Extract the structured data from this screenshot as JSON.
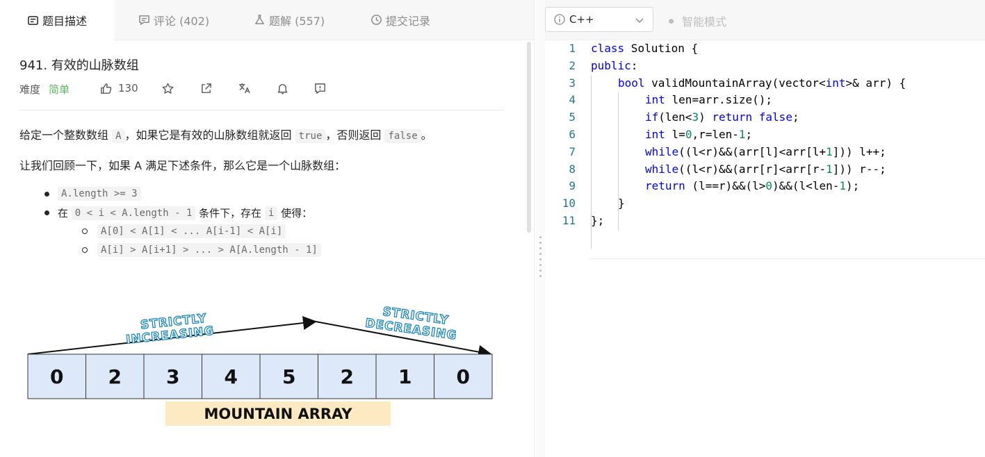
{
  "tabs": [
    {
      "label": "题目描述",
      "icon": "description-icon"
    },
    {
      "label": "评论 (402)",
      "icon": "comment-icon"
    },
    {
      "label": "题解 (557)",
      "icon": "flask-icon"
    },
    {
      "label": "提交记录",
      "icon": "clock-icon"
    }
  ],
  "problem": {
    "title": "941. 有效的山脉数组",
    "difficulty_label": "难度",
    "difficulty": "简单",
    "likes": "130"
  },
  "description": {
    "p1_a": "给定一个整数数组",
    "p1_code1": "A",
    "p1_b": "，如果它是有效的山脉数组就返回",
    "p1_code2": "true",
    "p1_c": "，否则返回",
    "p1_code3": "false",
    "p1_d": "。",
    "p2": "让我们回顾一下，如果 A 满足下述条件，那么它是一个山脉数组：",
    "b1_code": "A.length >= 3",
    "b2_a": "在",
    "b2_code1": "0 < i  < A.length - 1",
    "b2_b": "条件下，存在",
    "b2_code2": "i",
    "b2_c": "使得：",
    "b3_code": "A[0] < A[1] < ... A[i-1] < A[i]",
    "b4_code": "A[i] > A[i+1] > ... > A[A.length - 1]"
  },
  "diagram": {
    "left_label_1": "STRICTLY",
    "left_label_2": "INCREASING",
    "right_label_1": "STRICTLY",
    "right_label_2": "DECREASING",
    "values": [
      "0",
      "2",
      "3",
      "4",
      "5",
      "2",
      "1",
      "0"
    ],
    "caption": "MOUNTAIN ARRAY"
  },
  "editor": {
    "language": "C++",
    "smart_mode": "智能模式"
  },
  "code_lines": [
    {
      "n": "1",
      "indent": 0,
      "tokens": [
        {
          "t": "class",
          "c": "kw"
        },
        {
          "t": " Solution {",
          "c": ""
        }
      ]
    },
    {
      "n": "2",
      "indent": 0,
      "tokens": [
        {
          "t": "public",
          "c": "kw"
        },
        {
          "t": ":",
          "c": ""
        }
      ]
    },
    {
      "n": "3",
      "indent": 1,
      "tokens": [
        {
          "t": "bool",
          "c": "kw"
        },
        {
          "t": " validMountainArray(vector<",
          "c": ""
        },
        {
          "t": "int",
          "c": "kw"
        },
        {
          "t": ">& arr) {",
          "c": ""
        }
      ]
    },
    {
      "n": "4",
      "indent": 2,
      "tokens": [
        {
          "t": "int",
          "c": "kw"
        },
        {
          "t": " len=arr.size();",
          "c": ""
        }
      ]
    },
    {
      "n": "5",
      "indent": 2,
      "tokens": [
        {
          "t": "if",
          "c": "kw"
        },
        {
          "t": "(len<",
          "c": ""
        },
        {
          "t": "3",
          "c": "num"
        },
        {
          "t": ") ",
          "c": ""
        },
        {
          "t": "return",
          "c": "kw"
        },
        {
          "t": " ",
          "c": ""
        },
        {
          "t": "false",
          "c": "kw"
        },
        {
          "t": ";",
          "c": ""
        }
      ]
    },
    {
      "n": "6",
      "indent": 2,
      "tokens": [
        {
          "t": "int",
          "c": "kw"
        },
        {
          "t": " l=",
          "c": ""
        },
        {
          "t": "0",
          "c": "num"
        },
        {
          "t": ",r=len-",
          "c": ""
        },
        {
          "t": "1",
          "c": "num"
        },
        {
          "t": ";",
          "c": ""
        }
      ]
    },
    {
      "n": "7",
      "indent": 2,
      "tokens": [
        {
          "t": "while",
          "c": "kw"
        },
        {
          "t": "((l<r)&&(arr[l]<arr[l+",
          "c": ""
        },
        {
          "t": "1",
          "c": "num"
        },
        {
          "t": "])) l++;",
          "c": ""
        }
      ]
    },
    {
      "n": "8",
      "indent": 2,
      "tokens": [
        {
          "t": "while",
          "c": "kw"
        },
        {
          "t": "((l<r)&&(arr[r]<arr[r-",
          "c": ""
        },
        {
          "t": "1",
          "c": "num"
        },
        {
          "t": "])) r--;",
          "c": ""
        }
      ]
    },
    {
      "n": "9",
      "indent": 2,
      "tokens": [
        {
          "t": "return",
          "c": "kw"
        },
        {
          "t": " (l==r)&&(l>",
          "c": ""
        },
        {
          "t": "0",
          "c": "num"
        },
        {
          "t": ")&&(l<len-",
          "c": ""
        },
        {
          "t": "1",
          "c": "num"
        },
        {
          "t": ");",
          "c": ""
        }
      ]
    },
    {
      "n": "10",
      "indent": 1,
      "tokens": [
        {
          "t": "}",
          "c": ""
        }
      ]
    },
    {
      "n": "11",
      "indent": 0,
      "tokens": [
        {
          "t": "};",
          "c": ""
        }
      ]
    }
  ],
  "colors": {
    "keyword": "#0000ff",
    "number": "#098658",
    "line_number": "#237893",
    "easy": "#5cb85c",
    "diagram_cell": "#dde8f8",
    "caption_bg": "#fde9c2",
    "arrow_label": "#1a86c2"
  }
}
